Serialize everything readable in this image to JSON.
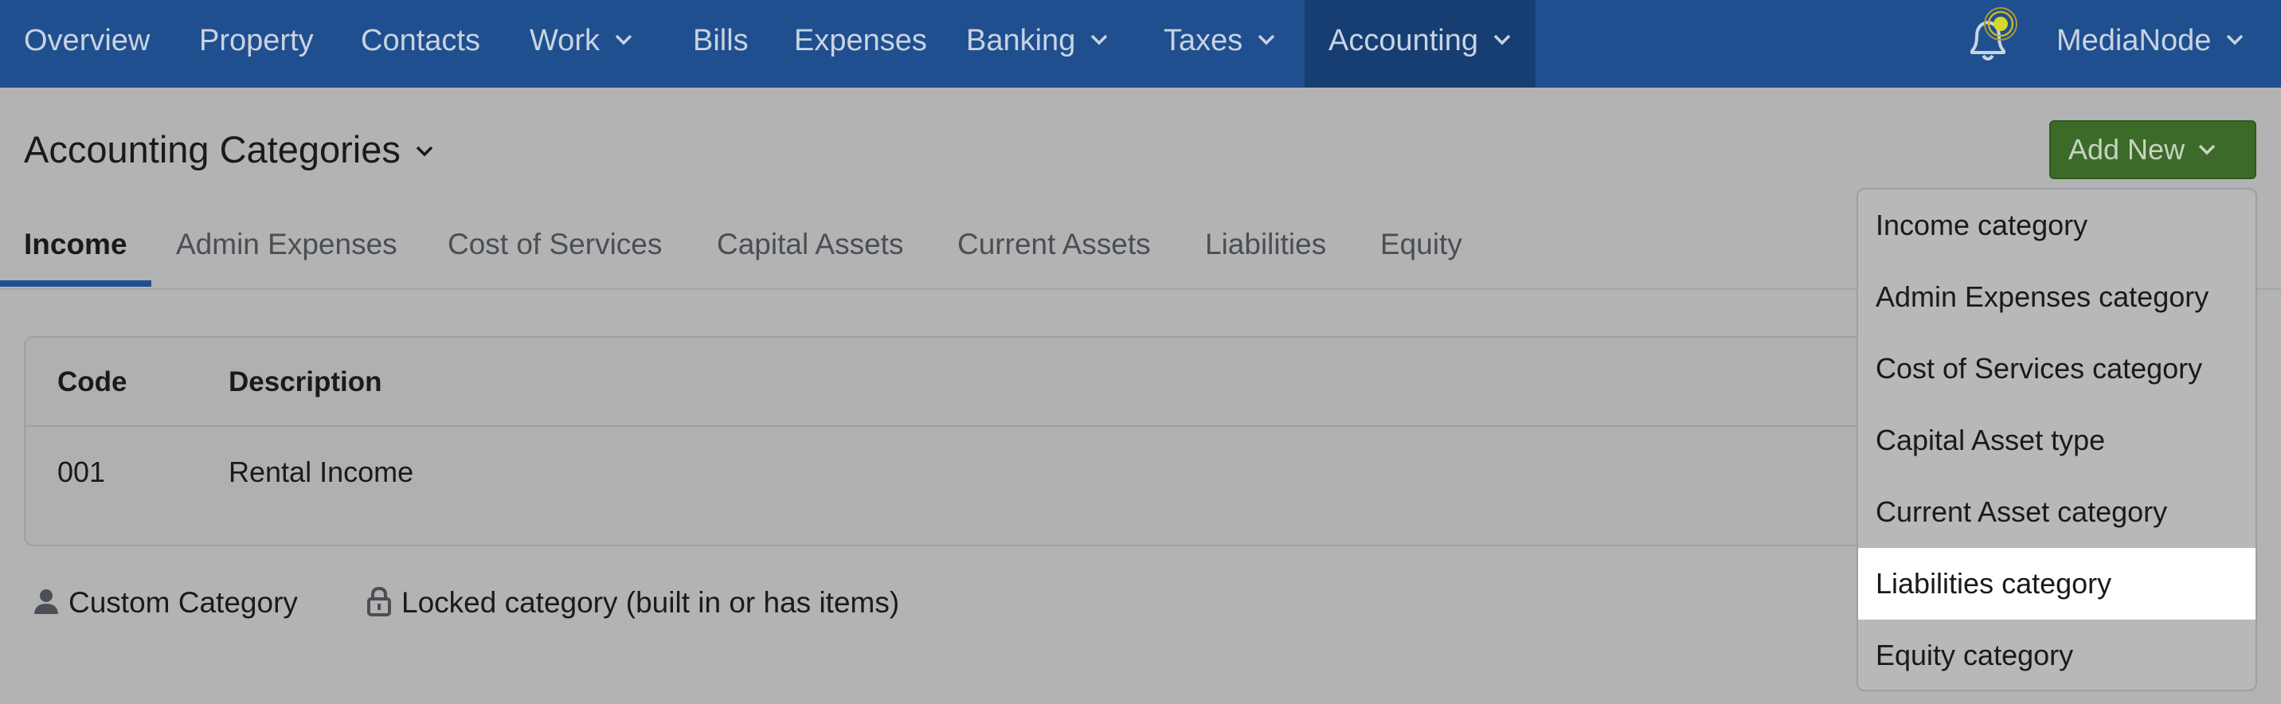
{
  "nav": {
    "items": [
      {
        "label": "Overview",
        "dropdown": false,
        "active": false
      },
      {
        "label": "Property",
        "dropdown": false,
        "active": false
      },
      {
        "label": "Contacts",
        "dropdown": false,
        "active": false
      },
      {
        "label": "Work",
        "dropdown": true,
        "active": false
      },
      {
        "label": "Bills",
        "dropdown": false,
        "active": false
      },
      {
        "label": "Expenses",
        "dropdown": false,
        "active": false
      },
      {
        "label": "Banking",
        "dropdown": true,
        "active": false
      },
      {
        "label": "Taxes",
        "dropdown": true,
        "active": false
      },
      {
        "label": "Accounting",
        "dropdown": true,
        "active": true
      }
    ],
    "account_label": "MediaNode",
    "notification_icon": "bell-icon"
  },
  "page": {
    "title": "Accounting Categories",
    "add_new_label": "Add New"
  },
  "tabs": [
    {
      "label": "Income",
      "active": true
    },
    {
      "label": "Admin Expenses",
      "active": false
    },
    {
      "label": "Cost of Services",
      "active": false
    },
    {
      "label": "Capital Assets",
      "active": false
    },
    {
      "label": "Current Assets",
      "active": false
    },
    {
      "label": "Liabilities",
      "active": false
    },
    {
      "label": "Equity",
      "active": false
    }
  ],
  "table": {
    "columns": [
      "Code",
      "Description"
    ],
    "rows": [
      {
        "code": "001",
        "description": "Rental Income"
      }
    ]
  },
  "legend": {
    "custom_label": "Custom Category",
    "custom_icon": "person-icon",
    "locked_label": "Locked category (built in or has items)",
    "locked_icon": "lock-icon"
  },
  "dropdown": {
    "items": [
      {
        "label": "Income category",
        "highlighted": false
      },
      {
        "label": "Admin Expenses category",
        "highlighted": false
      },
      {
        "label": "Cost of Services category",
        "highlighted": false
      },
      {
        "label": "Capital Asset type",
        "highlighted": false
      },
      {
        "label": "Current Asset category",
        "highlighted": false
      },
      {
        "label": "Liabilities category",
        "highlighted": true
      },
      {
        "label": "Equity category",
        "highlighted": false
      }
    ]
  },
  "colors": {
    "nav_bg": "#1f4f8f",
    "nav_active_bg": "#173e73",
    "add_new_bg": "#3c6b29",
    "tab_underline": "#1f4f8f",
    "notification_dot": "#d4d92a"
  }
}
